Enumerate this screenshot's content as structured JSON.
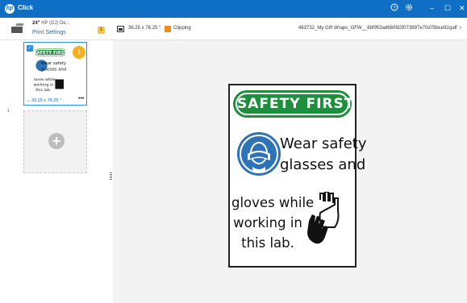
{
  "titlebar": {
    "logo": "hp",
    "title": "Click",
    "help_icon": "help-icon",
    "settings_icon": "gear-icon",
    "minimize_glyph": "–",
    "maximize_glyph": "☐",
    "close_glyph": "✕"
  },
  "toolbar": {
    "printer_model": "24\"",
    "printer_name_rest": "HP (DJ) De...",
    "print_settings_label": "Print Settings",
    "badge_count": "1",
    "size_label": "36.25 x 76.25 \"",
    "clipping_label": "Clipping",
    "clipping_color": "#f08c1e",
    "filename": "463732_My Gift Wraps_GFW__8bf953ad660fd2f073997e70d78bce92.pdf",
    "nav_prev": "‹",
    "nav_next": "›"
  },
  "sidebar": {
    "row_number": "1",
    "thumb_size_label": "36.25 x 76.25 \"",
    "thumb_more": "•••",
    "warning_glyph": "!",
    "add_glyph": "+"
  },
  "sign": {
    "banner_text": "SAFETY FIRST",
    "line1a": "Wear safety",
    "line1b": "glasses and",
    "line2a": "gloves while",
    "line2b": "working in",
    "line2c": "this lab.",
    "banner_color": "#1f8e3d",
    "circle_color": "#2e73b8"
  }
}
